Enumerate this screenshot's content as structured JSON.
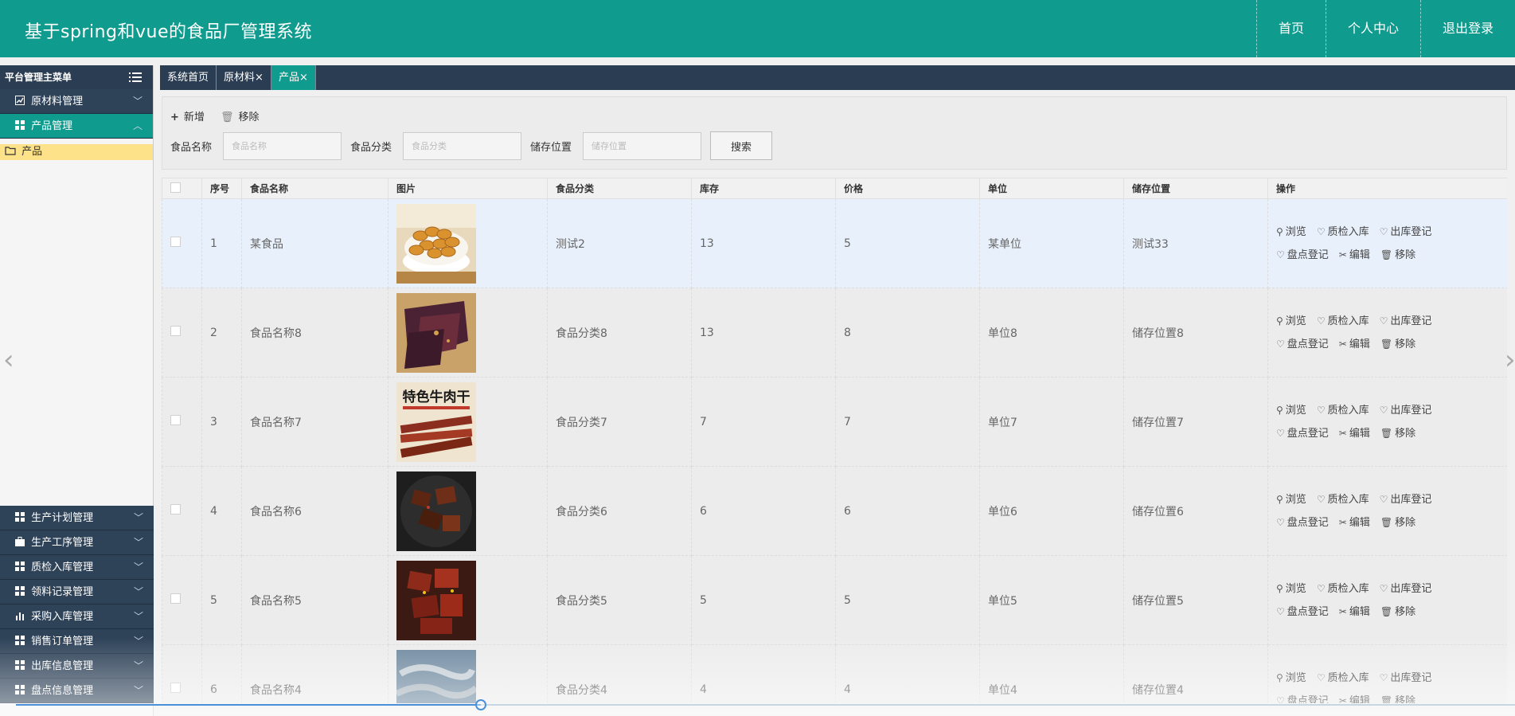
{
  "header": {
    "title": "基于spring和vue的食品厂管理系统",
    "nav": [
      "首页",
      "个人中心",
      "退出登录"
    ]
  },
  "sidebar": {
    "title": "平台管理主菜单",
    "top_items": [
      {
        "label": "原材料管理",
        "icon": "chart-icon",
        "expanded": false
      },
      {
        "label": "产品管理",
        "icon": "grid-icon",
        "expanded": true
      }
    ],
    "sub_items": [
      {
        "label": "产品",
        "icon": "folder-icon"
      }
    ],
    "bottom_items": [
      {
        "label": "生产计划管理",
        "icon": "grid-icon"
      },
      {
        "label": "生产工序管理",
        "icon": "briefcase-icon"
      },
      {
        "label": "质检入库管理",
        "icon": "grid-icon"
      },
      {
        "label": "领料记录管理",
        "icon": "grid-icon"
      },
      {
        "label": "采购入库管理",
        "icon": "bar-chart-icon"
      },
      {
        "label": "销售订单管理",
        "icon": "grid-icon"
      },
      {
        "label": "出库信息管理",
        "icon": "grid-icon"
      },
      {
        "label": "盘点信息管理",
        "icon": "grid-icon"
      }
    ]
  },
  "tabs": [
    {
      "label": "系统首页",
      "closable": false,
      "active": false
    },
    {
      "label": "原材料",
      "closable": true,
      "active": false
    },
    {
      "label": "产品",
      "closable": true,
      "active": true
    }
  ],
  "toolbar": {
    "add_label": "新增",
    "remove_label": "移除",
    "search_button": "搜索",
    "fields": [
      {
        "label": "食品名称",
        "placeholder": "食品名称",
        "value": ""
      },
      {
        "label": "食品分类",
        "placeholder": "食品分类",
        "value": ""
      },
      {
        "label": "储存位置",
        "placeholder": "储存位置",
        "value": ""
      }
    ]
  },
  "table": {
    "columns": [
      "序号",
      "食品名称",
      "图片",
      "食品分类",
      "库存",
      "价格",
      "单位",
      "储存位置",
      "操作"
    ],
    "actions_row1": [
      "浏览",
      "质检入库",
      "出库登记"
    ],
    "actions_row2": [
      "盘点登记",
      "编辑",
      "移除"
    ],
    "rows": [
      {
        "no": "1",
        "name": "某食品",
        "image": "cashew-nuts",
        "category": "测试2",
        "stock": "13",
        "price": "5",
        "unit": "某单位",
        "location": "测试33"
      },
      {
        "no": "2",
        "name": "食品名称8",
        "image": "dried-beef",
        "category": "食品分类8",
        "stock": "13",
        "price": "8",
        "unit": "单位8",
        "location": "储存位置8"
      },
      {
        "no": "3",
        "name": "食品名称7",
        "image": "beef-jerky-poster",
        "poster_text": "特色牛肉干",
        "category": "食品分类7",
        "stock": "7",
        "price": "7",
        "unit": "单位7",
        "location": "储存位置7"
      },
      {
        "no": "4",
        "name": "食品名称6",
        "image": "braised-meat",
        "category": "食品分类6",
        "stock": "6",
        "price": "6",
        "unit": "单位6",
        "location": "储存位置6"
      },
      {
        "no": "5",
        "name": "食品名称5",
        "image": "spicy-meat",
        "category": "食品分类5",
        "stock": "5",
        "price": "5",
        "unit": "单位5",
        "location": "储存位置5"
      },
      {
        "no": "6",
        "name": "食品名称4",
        "image": "dried-fish",
        "category": "食品分类4",
        "stock": "4",
        "price": "4",
        "unit": "单位4",
        "location": "储存位置4"
      }
    ]
  },
  "colors": {
    "primary": "#0f9b8e",
    "nav_dark": "#2b3d52",
    "highlight": "#fde28a"
  },
  "progress": 0.31
}
